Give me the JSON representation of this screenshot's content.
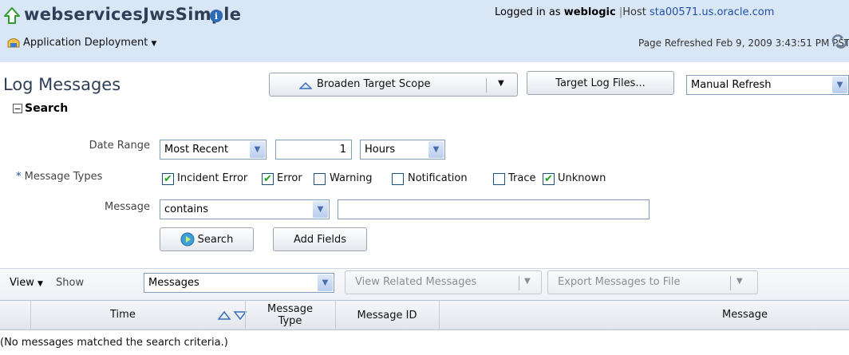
{
  "header": {
    "app_title": "webservicesJwsSimple",
    "info_icon": "i",
    "deployment_menu": "Application Deployment",
    "logged_in_prefix": "Logged in as",
    "user": "weblogic",
    "host_prefix": "Host",
    "host": "sta00571.us.oracle.com",
    "page_refreshed": "Page Refreshed Feb 9, 2009 3:43:51 PM PST"
  },
  "page": {
    "title": "Log Messages",
    "broaden_scope": "Broaden Target Scope",
    "target_log_files": "Target Log Files...",
    "refresh_mode": "Manual Refresh"
  },
  "search": {
    "section_title": "Search",
    "collapse_icon": "−",
    "date_range_label": "Date Range",
    "date_range_value": "Most Recent",
    "date_amount": "1",
    "date_unit": "Hours",
    "required_star": "*",
    "message_types_label": "Message Types",
    "message_types": [
      {
        "label": "Incident Error",
        "checked": true
      },
      {
        "label": "Error",
        "checked": true
      },
      {
        "label": "Warning",
        "checked": false
      },
      {
        "label": "Notification",
        "checked": false
      },
      {
        "label": "Trace",
        "checked": false
      },
      {
        "label": "Unknown",
        "checked": true
      }
    ],
    "message_label": "Message",
    "message_operator": "contains",
    "message_value": "",
    "search_button": "Search",
    "add_fields_button": "Add Fields"
  },
  "toolbar": {
    "view_menu": "View",
    "show_label": "Show",
    "show_value": "Messages",
    "view_related": "View Related Messages",
    "export": "Export Messages to File"
  },
  "table": {
    "columns": [
      "Time",
      "Message Type",
      "Message ID",
      "Message"
    ],
    "empty_text": "(No messages matched the search criteria.)"
  },
  "colors": {
    "header_band": "#d9e6f5",
    "link": "#1f4fa8",
    "check": "#21a121"
  }
}
